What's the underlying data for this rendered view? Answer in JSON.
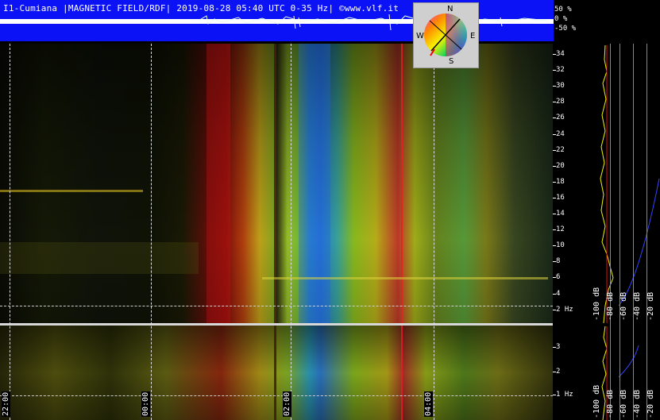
{
  "header": {
    "title": "I1-Cumiana |MAGNETIC FIELD/RDF| 2019-08-28 05:40 UTC 0-35 Hz| ©www.vlf.it",
    "percent_scale": [
      "50 %",
      "0 %",
      "-50 %"
    ]
  },
  "compass": {
    "north": "N",
    "east": "E",
    "south": "S",
    "west": "W"
  },
  "frequency_axis_top": [
    "34",
    "32",
    "30",
    "28",
    "26",
    "24",
    "22",
    "20",
    "18",
    "16",
    "14",
    "12",
    "10",
    "8",
    "6",
    "4",
    "2 Hz"
  ],
  "frequency_axis_bottom": [
    "3",
    "2",
    "1 Hz"
  ],
  "db_scale": [
    "-100 dB",
    "-80 dB",
    "-60 dB",
    "-40 dB",
    "-20 dB"
  ],
  "time_labels": [
    "22:00",
    "00:00",
    "02:00",
    "04:00"
  ],
  "colors": {
    "header_blue": "#0b12f5",
    "trace_yellow": "#f2f20a",
    "trace_red": "#e01010"
  }
}
